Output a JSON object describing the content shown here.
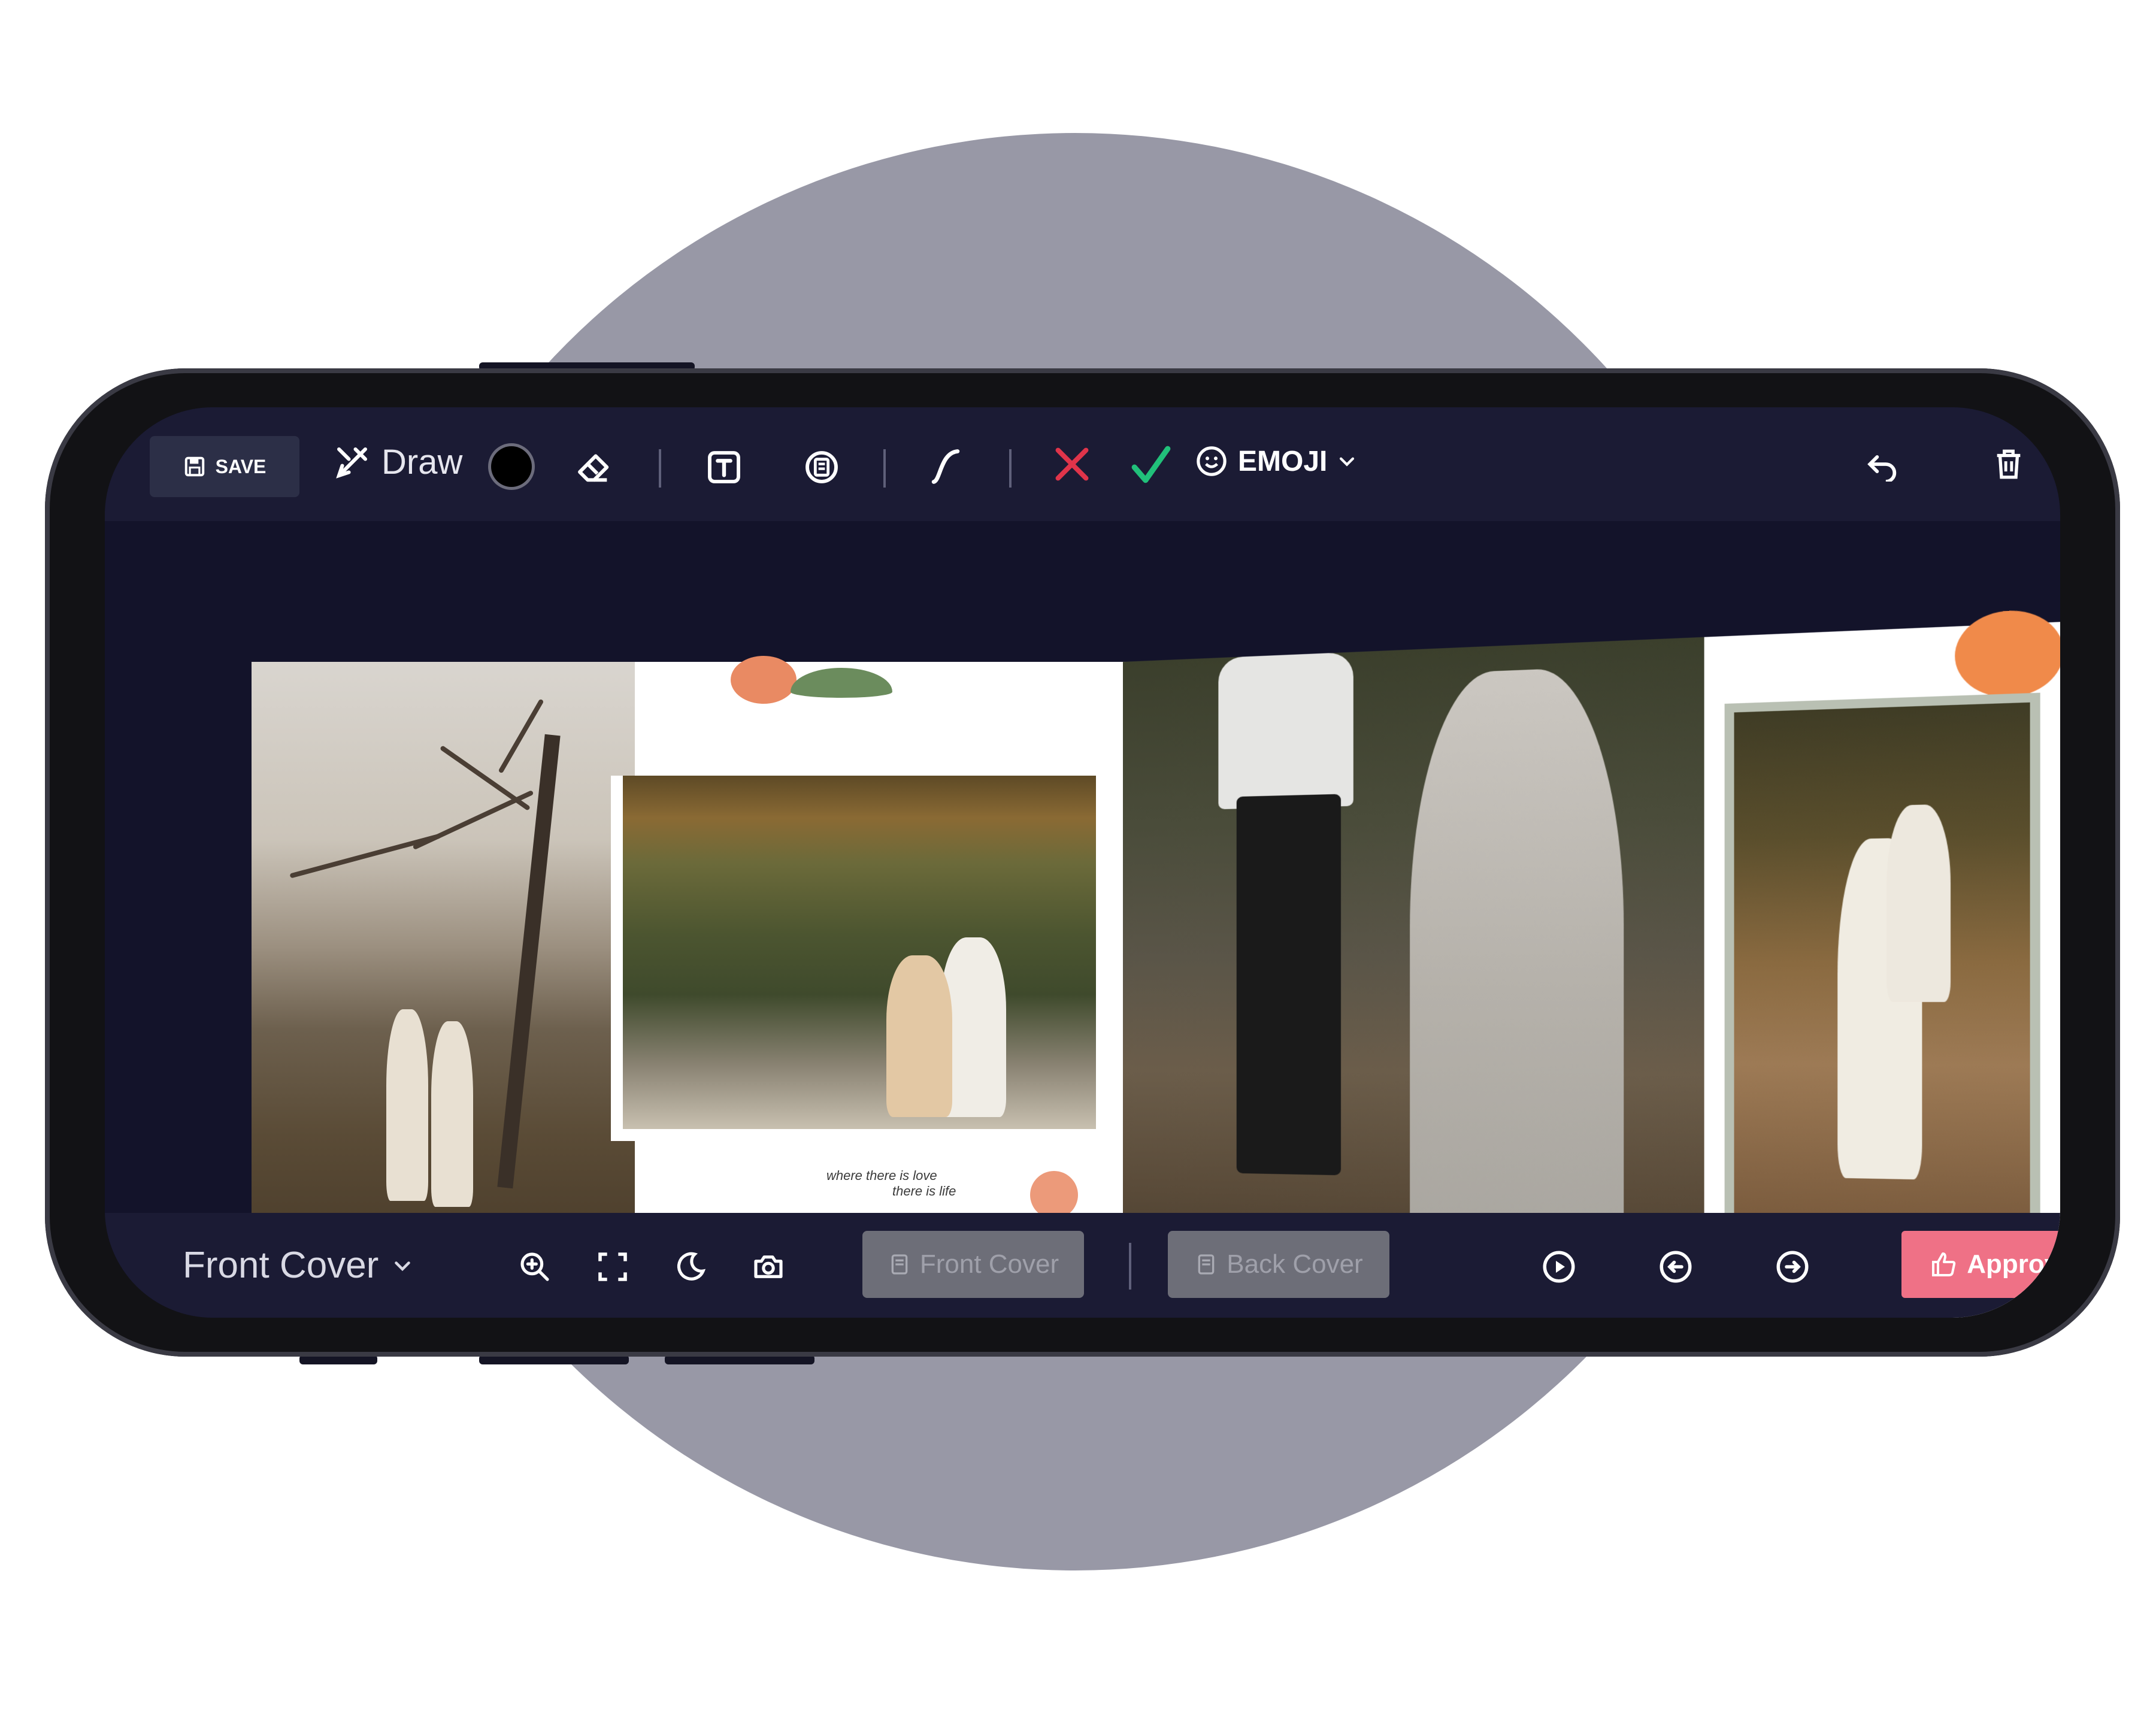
{
  "toolbar": {
    "save_label": "SAVE",
    "draw_label": "Draw",
    "emoji_label": "EMOJI"
  },
  "page_text": {
    "line1": "where there is love",
    "line2": "there is life"
  },
  "bottom": {
    "cover_select": "Front Cover",
    "front_cover_label": "Front Cover",
    "back_cover_label": "Back Cover",
    "approve_label": "Approve"
  },
  "icons": [
    "save-icon",
    "draw-icon",
    "color-swatch",
    "eraser-icon",
    "text-icon",
    "sticker-icon",
    "curve-icon",
    "cancel-icon",
    "confirm-icon",
    "emoji-icon",
    "chevron-down-icon",
    "undo-icon",
    "delete-icon",
    "zoom-in-icon",
    "fullscreen-icon",
    "dark-mode-icon",
    "camera-icon",
    "play-icon",
    "prev-icon",
    "next-icon",
    "thumbs-up-icon"
  ],
  "colors": {
    "accent_approve": "#ef7186",
    "cancel_red": "#e0344a",
    "confirm_green": "#21c07a",
    "toolbar_bg": "#1b1b34"
  }
}
